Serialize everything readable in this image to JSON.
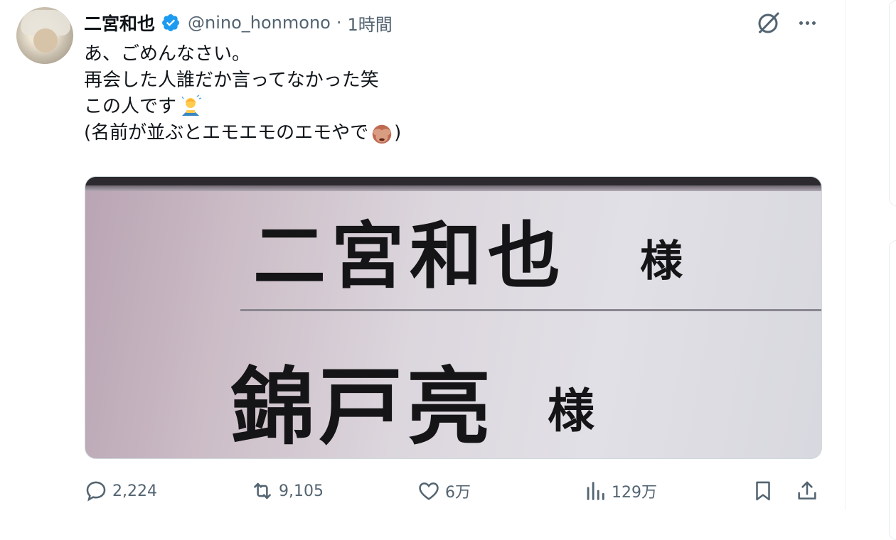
{
  "tweet": {
    "author": {
      "display_name": "二宮和也",
      "verified": true,
      "handle": "@nino_honmono",
      "separator": "·",
      "time": "1時間"
    },
    "text_lines": [
      "あ、ごめんなさい。",
      "再会した人誰だか言ってなかった笑",
      "この人です",
      "(名前が並ぶとエモエモのエモやで",
      ")"
    ],
    "emojis": [
      "person-bowing-emoji",
      "see-no-evil-monkey-emoji"
    ],
    "media": {
      "name_1": "二宮和也",
      "honorific_1": "様",
      "name_2": "錦戸亮",
      "honorific_2": "様"
    },
    "actions": {
      "replies": "2,224",
      "reposts": "9,105",
      "likes": "6万",
      "views": "129万"
    }
  },
  "colors": {
    "text_primary": "#0f1419",
    "text_secondary": "#536471",
    "verified_blue": "#1d9bf0",
    "border": "#cfd9de"
  }
}
